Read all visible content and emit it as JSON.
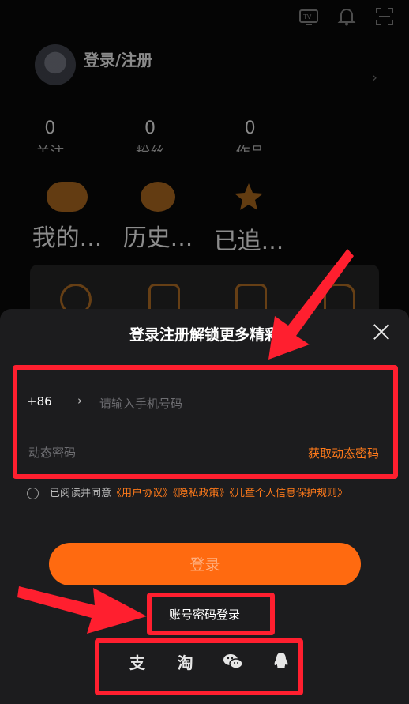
{
  "background": {
    "login_link": "登录/注册",
    "stats": [
      {
        "num": "0",
        "label": "关注"
      },
      {
        "num": "0",
        "label": "粉丝"
      },
      {
        "num": "0",
        "label": "作品"
      }
    ],
    "quick": [
      "我的...",
      "历史...",
      "已追..."
    ]
  },
  "sheet": {
    "title": "登录注册解锁更多精彩",
    "country_code": "+86",
    "phone_placeholder": "请输入手机号码",
    "code_placeholder": "动态密码",
    "get_code": "获取动态密码",
    "agree_prefix": "已阅读并同意",
    "links": [
      "《用户协议》",
      "《隐私政策》",
      "《儿童个人信息保护规则》"
    ],
    "login_button": "登录",
    "account_login": "账号密码登录",
    "social": [
      {
        "icon": "alipay-icon",
        "glyph": "支"
      },
      {
        "icon": "taobao-icon",
        "glyph": "淘"
      },
      {
        "icon": "wechat-icon",
        "glyph": ""
      },
      {
        "icon": "qq-icon",
        "glyph": ""
      }
    ]
  },
  "colors": {
    "accent": "#ff6a10",
    "link": "#ff7a1a",
    "annotation": "#ff1f2f"
  }
}
